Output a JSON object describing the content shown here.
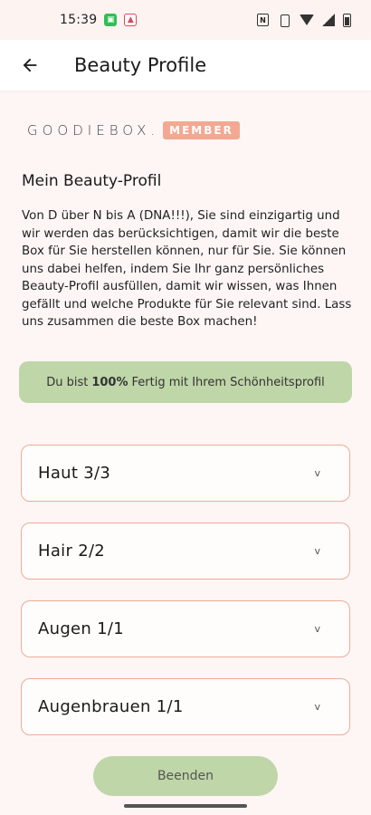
{
  "status_bar": {
    "time": "15:39",
    "icons": [
      "app-notification-icon",
      "gallery-notification-icon",
      "nfc-icon",
      "vibrate-icon",
      "wifi-icon",
      "signal-icon",
      "battery-icon"
    ]
  },
  "appbar": {
    "back_icon": "arrow-left-icon",
    "title": "Beauty Profile"
  },
  "brand": {
    "name": "GOODIEBOX.",
    "badge": "MEMBER",
    "badge_color": "#f3a892"
  },
  "profile": {
    "title": "Mein Beauty-Profil",
    "intro": "Von D über N bis A (DNA!!!), Sie sind einzigartig und wir werden das berücksichtigen, damit wir die beste Box für Sie herstellen können, nur für Sie. Sie können uns dabei helfen, indem Sie Ihr ganz persönliches Beauty-Profil ausfüllen, damit wir wissen, was Ihnen gefällt und welche Produkte für Sie relevant sind. Lass uns zusammen die beste Box machen!"
  },
  "progress": {
    "prefix": "Du bist",
    "percent": "100%",
    "suffix": "Fertig mit Ihrem Schönheitsprofil",
    "color": "#bfd6a8"
  },
  "sections": [
    {
      "label": "Haut 3/3",
      "chevron": "v"
    },
    {
      "label": "Hair 2/2",
      "chevron": "v"
    },
    {
      "label": "Augen 1/1",
      "chevron": "v"
    },
    {
      "label": "Augenbrauen 1/1",
      "chevron": "v"
    }
  ],
  "accent_colors": {
    "border": "#ecab97",
    "background": "#fdf6f4"
  },
  "finish_button": {
    "label": "Beenden"
  }
}
